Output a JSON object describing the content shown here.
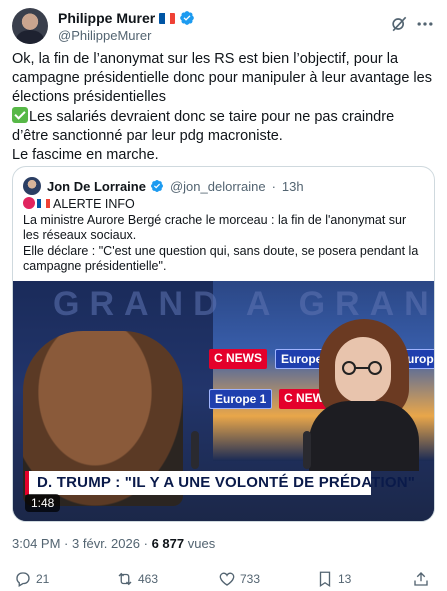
{
  "author": {
    "name": "Philippe Murer",
    "handle": "@PhilippeMurer",
    "flag_colors": [
      "#0055a4",
      "#ffffff",
      "#ef4135"
    ]
  },
  "tweet": {
    "paragraph1": "Ok, la fin de l’anonymat sur les RS est bien l’objectif, pour la campagne présidentielle donc pour manipuler à leur avantage les élections présidentielles",
    "paragraph2": "Les salariés devraient donc se taire pour ne pas craindre d’être sanctionné par leur pdg macroniste.",
    "paragraph3": "Le fascime en marche."
  },
  "quote": {
    "name": "Jon De Lorraine",
    "handle": "@jon_delorraine",
    "separator": "·",
    "time": "13h",
    "alert_label": "ALERTE INFO",
    "line1": "La ministre Aurore Bergé crache le morceau : la fin de l'anonymat sur les réseaux sociaux.",
    "line2": "Elle déclare : \"C'est une question qui, sans doute, se posera pendant la campagne présidentielle\".",
    "video": {
      "wall_text": "GRAND A GRAN",
      "logo_cnews": "C NEWS",
      "logo_europe": "Europe 1",
      "ticker": "D. TRUMP : \"IL Y A UNE VOLONTÉ DE PRÉDATION\"",
      "duration": "1:48"
    }
  },
  "meta": {
    "time": "3:04 PM",
    "date": "3 févr. 2026",
    "separator": "·",
    "views_count": "6 877",
    "views_label": "vues"
  },
  "actions": {
    "replies": "21",
    "reposts": "463",
    "likes": "733",
    "bookmarks": "13"
  },
  "colors": {
    "text": "#0f1419",
    "secondary": "#536471",
    "verified": "#1d9bf0",
    "border": "#cfd9de"
  }
}
